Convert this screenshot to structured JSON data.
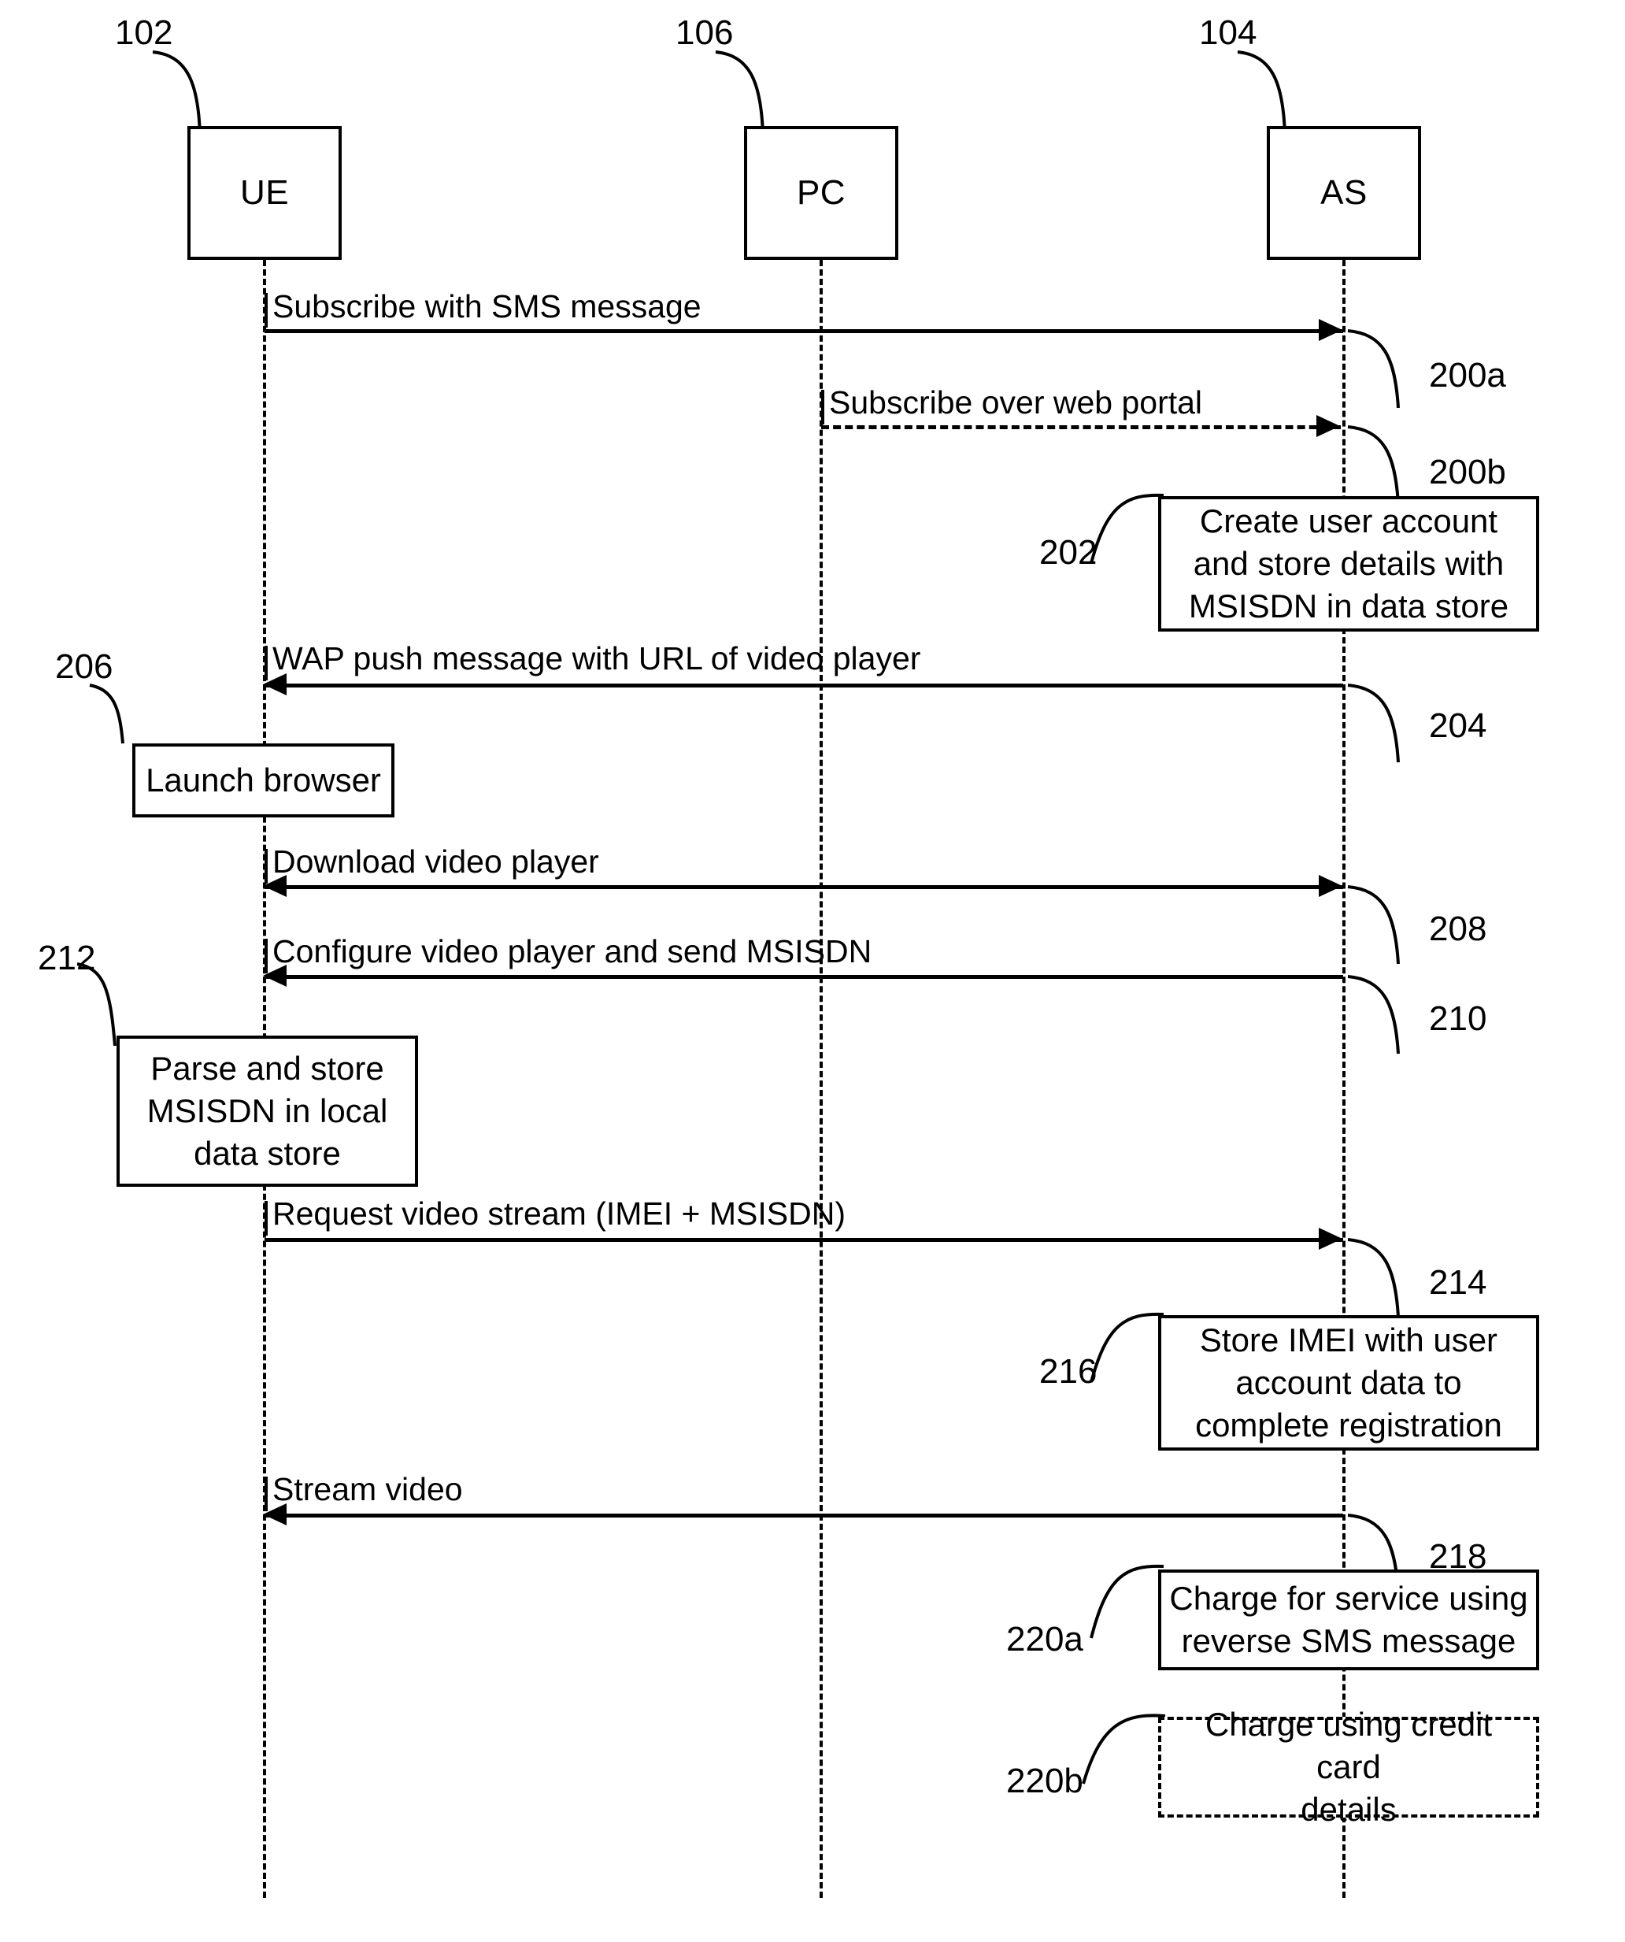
{
  "figure": {
    "type": "sequence-diagram",
    "actors": [
      {
        "id": "ue",
        "label": "UE",
        "ref": "102"
      },
      {
        "id": "pc",
        "label": "PC",
        "ref": "106"
      },
      {
        "id": "as",
        "label": "AS",
        "ref": "104"
      }
    ],
    "messages": [
      {
        "ref": "200a",
        "label": "Subscribe with SMS message",
        "from": "ue",
        "to": "as",
        "style": "solid",
        "direction": "right"
      },
      {
        "ref": "200b",
        "label": "Subscribe over web portal",
        "from": "pc",
        "to": "as",
        "style": "dashed",
        "direction": "right"
      },
      {
        "ref": "204",
        "label": "WAP push message with URL of video player",
        "from": "as",
        "to": "ue",
        "style": "solid",
        "direction": "left"
      },
      {
        "ref": "208",
        "label": "Download video player",
        "from": "ue",
        "to": "as",
        "style": "solid",
        "direction": "both"
      },
      {
        "ref": "210",
        "label": "Configure video player and send MSISDN",
        "from": "as",
        "to": "ue",
        "style": "solid",
        "direction": "left"
      },
      {
        "ref": "214",
        "label": "Request video stream (IMEI + MSISDN)",
        "from": "ue",
        "to": "as",
        "style": "solid",
        "direction": "right"
      },
      {
        "ref": "218",
        "label": "Stream video",
        "from": "as",
        "to": "ue",
        "style": "solid",
        "direction": "left"
      }
    ],
    "process_boxes": [
      {
        "ref": "202",
        "text": "Create user account and store details with MSISDN in data store",
        "on": "as",
        "style": "solid"
      },
      {
        "ref": "206",
        "text": "Launch browser",
        "on": "ue",
        "style": "solid"
      },
      {
        "ref": "212",
        "text": "Parse and store MSISDN in local data store",
        "on": "ue",
        "style": "solid"
      },
      {
        "ref": "216",
        "text": "Store IMEI with user account data to complete registration",
        "on": "as",
        "style": "solid"
      },
      {
        "ref": "220a",
        "text": "Charge for service using reverse SMS message",
        "on": "as",
        "style": "solid"
      },
      {
        "ref": "220b",
        "text": "Charge using credit card details",
        "on": "as",
        "style": "dashed"
      }
    ],
    "proc_lines": {
      "p202": [
        "Create user account",
        "and store details with",
        "MSISDN in data store"
      ],
      "p206": [
        "Launch browser"
      ],
      "p212": [
        "Parse and store",
        "MSISDN in local",
        "data store"
      ],
      "p216": [
        "Store IMEI with user",
        "account data to",
        "complete registration"
      ],
      "p220a": [
        "Charge for service using",
        "reverse SMS message"
      ],
      "p220b": [
        "Charge using credit card",
        "details"
      ]
    },
    "colors": {
      "ink": "#000000",
      "paper": "#ffffff"
    }
  }
}
